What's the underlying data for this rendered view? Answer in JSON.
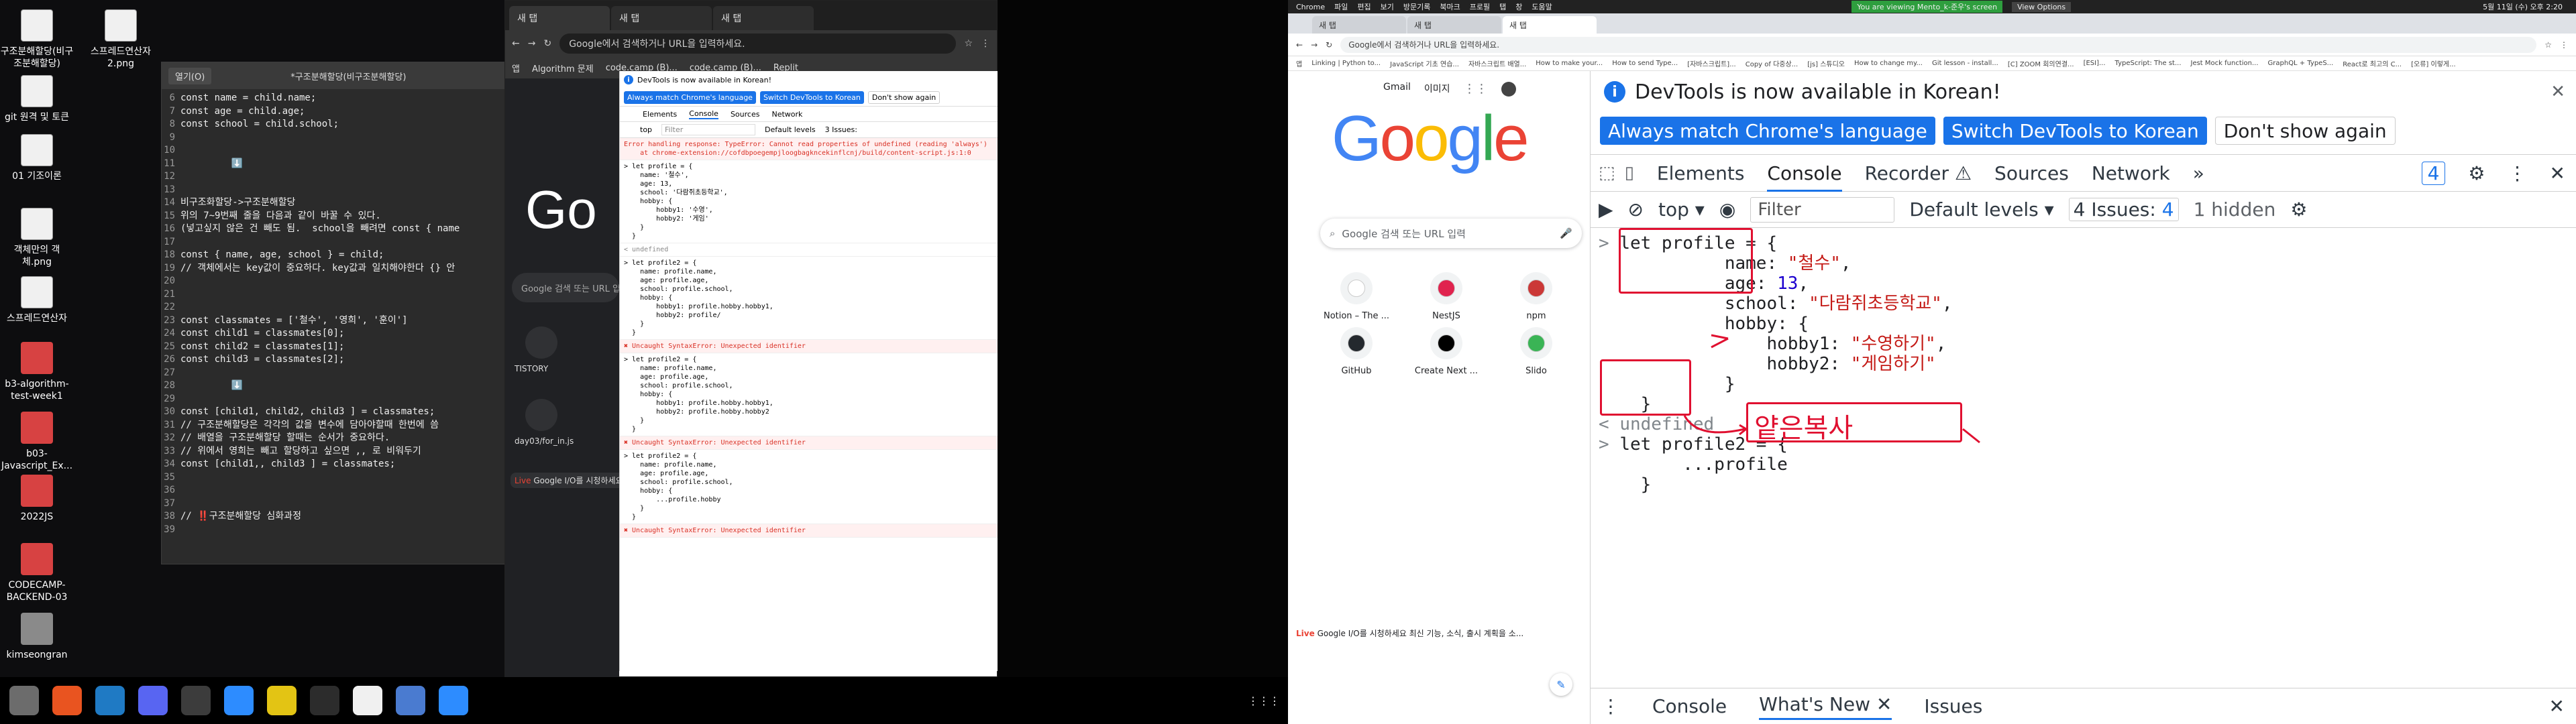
{
  "desktop": {
    "icons": [
      {
        "label": "구조분해할당(비구조분해할당)"
      },
      {
        "label": "스프레드연산자2.png"
      },
      {
        "label": "git 원격 및 토큰"
      },
      {
        "label": "01 기조이론"
      },
      {
        "label": "객체만의 객체.png"
      },
      {
        "label": "스프레드연산자"
      },
      {
        "label": "b3-algorithm-test-week1"
      },
      {
        "label": "b03-Javascript_Ex..."
      },
      {
        "label": "2022JS"
      },
      {
        "label": "CODECAMP-BACKEND-03"
      },
      {
        "label": "kimseongran"
      }
    ]
  },
  "editor": {
    "open_label": "열기(O)",
    "title": "*구조분해할당(비구조분해할당)",
    "lines": [
      {
        "n": "6",
        "t": "const name = child.name;"
      },
      {
        "n": "7",
        "t": "const age = child.age;"
      },
      {
        "n": "8",
        "t": "const school = child.school;"
      },
      {
        "n": "9",
        "t": ""
      },
      {
        "n": "10",
        "t": ""
      },
      {
        "n": "11",
        "t": "         ⬇️"
      },
      {
        "n": "12",
        "t": ""
      },
      {
        "n": "13",
        "t": ""
      },
      {
        "n": "14",
        "t": "비구조화할당->구조분해할당"
      },
      {
        "n": "15",
        "t": "위의 7~9번째 줄을 다음과 같이 바꿀 수 있다."
      },
      {
        "n": "16",
        "t": "(넣고싶지 않은 건 빼도 됨.  school을 빼려면 const { name"
      },
      {
        "n": "17",
        "t": ""
      },
      {
        "n": "18",
        "t": "const { name, age, school } = child;"
      },
      {
        "n": "19",
        "t": "// 객체에서는 key값이 중요하다. key값과 일치해야한다 {} 안"
      },
      {
        "n": "20",
        "t": ""
      },
      {
        "n": "21",
        "t": ""
      },
      {
        "n": "22",
        "t": ""
      },
      {
        "n": "23",
        "t": "const classmates = ['철수', '영희', '훈이']"
      },
      {
        "n": "24",
        "t": "const child1 = classmates[0];"
      },
      {
        "n": "25",
        "t": "const child2 = classmates[1];"
      },
      {
        "n": "26",
        "t": "const child3 = classmates[2];"
      },
      {
        "n": "27",
        "t": ""
      },
      {
        "n": "28",
        "t": "         ⬇️"
      },
      {
        "n": "29",
        "t": ""
      },
      {
        "n": "30",
        "t": "const [child1, child2, child3 ] = classmates;"
      },
      {
        "n": "31",
        "t": "// 구조분해할당은 각각의 값을 변수에 담아야할때 한번에 씀"
      },
      {
        "n": "32",
        "t": "// 배열을 구조분해할당 할때는 순서가 중요하다."
      },
      {
        "n": "33",
        "t": "// 위에서 영희는 빼고 할당하고 싶으면 ,, 로 비워두기"
      },
      {
        "n": "34",
        "t": "const [child1,, child3 ] = classmates;"
      },
      {
        "n": "35",
        "t": ""
      },
      {
        "n": "36",
        "t": ""
      },
      {
        "n": "37",
        "t": ""
      },
      {
        "n": "38",
        "t": "// ‼️구조분해할당 심화과정"
      },
      {
        "n": "39",
        "t": ""
      }
    ]
  },
  "chrome_left": {
    "tabs": [
      "새 탭",
      "새 탭",
      "새 탭"
    ],
    "omnibox": "Google에서 검색하거나 URL을 입력하세요.",
    "bookmarks": [
      "앱",
      "Algorithm 문제",
      "code.camp (B)...",
      "code.camp (B)...",
      "Replit"
    ],
    "search_placeholder": "Google 검색 또는 URL 입력",
    "shortcuts": [
      "TISTORY",
      "day03/for_in.js"
    ],
    "footer_live": "Live",
    "footer_text": "Google I/O를 시청하세요",
    "devtools": {
      "banner": "DevTools is now available in Korean!",
      "btn_always": "Always match Chrome's language",
      "btn_switch": "Switch DevTools to Korean",
      "btn_dont": "Don't show again",
      "tabs": [
        "Elements",
        "Console",
        "Sources",
        "Network"
      ],
      "filter": "Filter",
      "levels": "Default levels",
      "issues": "3 Issues:",
      "context": "top",
      "entries": [
        {
          "type": "error",
          "text": "Error handling response: TypeError: Cannot read properties of undefined (reading 'always')\n    at chrome-extension://cofdbpoegempjloogbagkncekinflcnj/build/content-script.js:1:0"
        },
        {
          "type": "code",
          "text": "> let profile = {\n    name: '철수',\n    age: 13,\n    school: '다람쥐초등학교',\n    hobby: {\n        hobby1: '수영',\n        hobby2: '게임'\n    }\n  }"
        },
        {
          "type": "undef",
          "text": "< undefined"
        },
        {
          "type": "code",
          "text": "> let profile2 = {\n    name: profile.name,\n    age: profile.age,\n    school: profile.school,\n    hobby: {\n        hobby1: profile.hobby.hobby1,\n        hobby2: profile/\n    }\n  }"
        },
        {
          "type": "error",
          "text": "✖ Uncaught SyntaxError: Unexpected identifier"
        },
        {
          "type": "code",
          "text": "> let profile2 = {\n    name: profile.name,\n    age: profile.age,\n    school: profile.school,\n    hobby: {\n        hobby1: profile.hobby.hobby1,\n        hobby2: profile.hobby.hobby2\n    }\n  }"
        },
        {
          "type": "error",
          "text": "✖ Uncaught SyntaxError: Unexpected identifier"
        },
        {
          "type": "code",
          "text": "> let profile2 = {\n    name: profile.name,\n    age: profile.age,\n    school: profile.school,\n    hobby: {\n        ...profile.hobby\n    }\n  }"
        },
        {
          "type": "error",
          "text": "✖ Uncaught SyntaxError: Unexpected identifier"
        }
      ]
    }
  },
  "right": {
    "os_menu": [
      "Chrome",
      "파일",
      "편집",
      "보기",
      "방문기록",
      "북마크",
      "프로필",
      "탭",
      "창",
      "도움말"
    ],
    "viewing_badge": "You are viewing Mento_k-준우's screen",
    "view_options": "View Options",
    "clock": "5월 11일 (수) 오후 2:20",
    "tabs": [
      "새 탭",
      "새 탭",
      "새 탭"
    ],
    "omnibox": "Google에서 검색하거나 URL을 입력하세요.",
    "bookmarks": [
      "앱",
      "Linking | Python to...",
      "JavaScript 기초 연습...",
      "자바스크립트 배열...",
      "How to make your...",
      "How to send Type...",
      "[자바스크립트]...",
      "Copy of 다중상...",
      "[js] 스튜디오",
      "How to change my...",
      "Git lesson - install...",
      "[C] ZOOM 회의연결...",
      "[ESI]...",
      "TypeScript: The st...",
      "Jest Mock function...",
      "GraphQL + TypeS...",
      "React로 최고의 C...",
      "[오류] 이렇게..."
    ],
    "google": {
      "gmail": "Gmail",
      "images": "이미지",
      "logo": [
        "G",
        "o",
        "o",
        "g",
        "l",
        "e"
      ],
      "search_placeholder": "Google 검색 또는 URL 입력",
      "shortcuts": [
        {
          "label": "Notion – The ...",
          "icon": "notion-icon",
          "color": "#ffffff"
        },
        {
          "label": "NestJS",
          "icon": "nestjs-icon",
          "color": "#e0234e"
        },
        {
          "label": "npm",
          "icon": "npm-icon",
          "color": "#cb3837"
        },
        {
          "label": "GitHub",
          "icon": "github-icon",
          "color": "#24292e"
        },
        {
          "label": "Create Next ...",
          "icon": "next-icon",
          "color": "#000000"
        },
        {
          "label": "Slido",
          "icon": "slido-icon",
          "color": "#3ab455"
        }
      ],
      "live": "Live",
      "footer": "Google I/O를 시청하세요 최신 기능, 소식, 출시 계획을 소..."
    },
    "devtools": {
      "banner": "DevTools is now available in Korean!",
      "btn_always": "Always match Chrome's language",
      "btn_switch": "Switch DevTools to Korean",
      "btn_dont": "Don't show again",
      "tabs": [
        "Elements",
        "Console",
        "Recorder ⚠",
        "Sources",
        "Network"
      ],
      "badge": "4",
      "context": "top",
      "filter": "Filter",
      "levels": "Default levels",
      "issues": "4 Issues:",
      "issues_count": "4",
      "hidden": "1 hidden",
      "console": {
        "l1": "let profile = {",
        "name_k": "name: ",
        "name_v": "\"철수\"",
        "age_k": "age: ",
        "age_v": "13",
        "school_k": "school: ",
        "school_v": "\"다람쥐초등학교\"",
        "hobby_k": "hobby: {",
        "h1_k": "hobby1: ",
        "h1_v": "\"수영하기\"",
        "h2_k": "hobby2: ",
        "h2_v": "\"게임하기\"",
        "close_inner": "}",
        "close_outer": "}",
        "undefined": "undefined",
        "l2": "let profile2 = {",
        "spread": "...profile",
        "close2": "}"
      },
      "annotation": "얕은복사",
      "drawer_tabs": [
        "Console",
        "What's New",
        "Issues"
      ]
    }
  },
  "taskbar": {
    "apps": [
      {
        "icon": "files-icon",
        "color": "#6c6c6c"
      },
      {
        "icon": "software-icon",
        "color": "#e95420"
      },
      {
        "icon": "vscode-icon",
        "color": "#1f7ac4"
      },
      {
        "icon": "discord-icon",
        "color": "#5865f2"
      },
      {
        "icon": "chrome-icon",
        "color": "#3c3c3c"
      },
      {
        "icon": "zoom-icon",
        "color": "#2d8cff"
      },
      {
        "icon": "video-icon",
        "color": "#e3c414"
      },
      {
        "icon": "terminal-icon",
        "color": "#2c2c2c"
      },
      {
        "icon": "text-editor-icon",
        "color": "#f0f0f0"
      },
      {
        "icon": "screenshot-icon",
        "color": "#4a7bd0"
      },
      {
        "icon": "zoom2-icon",
        "color": "#2d8cff"
      }
    ]
  }
}
